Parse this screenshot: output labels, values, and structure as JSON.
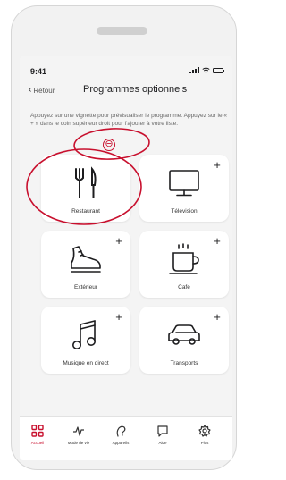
{
  "status_bar": {
    "time": "9:41"
  },
  "header": {
    "back_label": "Retour",
    "title": "Programmes optionnels"
  },
  "instructions": "Appuyez sur une vignette pour prévisualiser le programme. Appuyez sur le « + » dans le coin supérieur droit pour l'ajouter à votre liste.",
  "cards": [
    {
      "label": "Restaurant",
      "icon": "fork-knife-icon",
      "state": "added",
      "action": "⊖"
    },
    {
      "label": "Télévision",
      "icon": "television-icon",
      "state": "available",
      "action": "+"
    },
    {
      "label": "Extérieur",
      "icon": "shoe-icon",
      "state": "available",
      "action": "+"
    },
    {
      "label": "Café",
      "icon": "coffee-cup-icon",
      "state": "available",
      "action": "+"
    },
    {
      "label": "Musique en direct",
      "icon": "music-note-icon",
      "state": "available",
      "action": "+"
    },
    {
      "label": "Transports",
      "icon": "car-icon",
      "state": "available",
      "action": "+"
    }
  ],
  "tabs": [
    {
      "label": "Accueil",
      "icon": "grid-icon",
      "active": true
    },
    {
      "label": "Mode de vie",
      "icon": "pulse-icon",
      "active": false
    },
    {
      "label": "Appareils",
      "icon": "hearing-aid-icon",
      "active": false
    },
    {
      "label": "Aide",
      "icon": "chat-bubble-icon",
      "active": false
    },
    {
      "label": "Plus",
      "icon": "gear-icon",
      "active": false
    }
  ],
  "colors": {
    "accent": "#c8102e",
    "card": "#ffffff",
    "screen_bg": "#f4f4f4",
    "text": "#1d1d1f"
  }
}
